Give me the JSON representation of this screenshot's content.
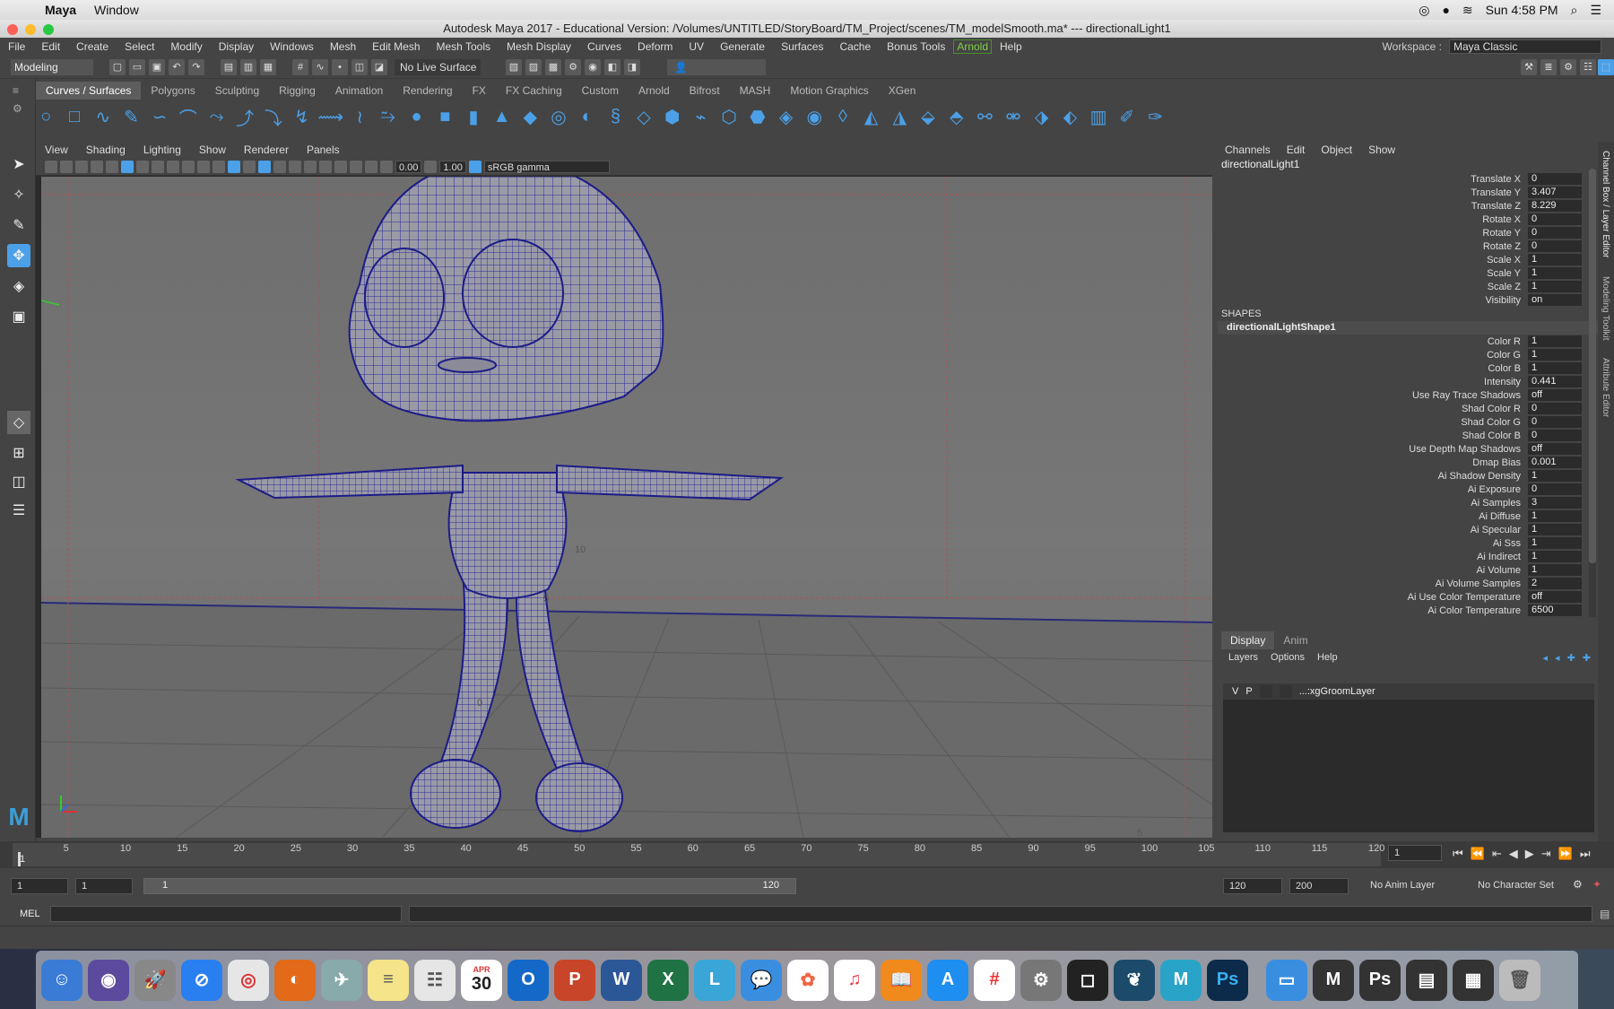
{
  "macos_menubar": {
    "app_name": "Maya",
    "menu": [
      "Window"
    ],
    "clock": "Sun 4:58 PM"
  },
  "window": {
    "title": "Autodesk Maya 2017 - Educational Version: /Volumes/UNTITLED/StoryBoard/TM_Project/scenes/TM_modelSmooth.ma*  ---  directionalLight1"
  },
  "main_menu": [
    "File",
    "Edit",
    "Create",
    "Select",
    "Modify",
    "Display",
    "Windows",
    "Mesh",
    "Edit Mesh",
    "Mesh Tools",
    "Mesh Display",
    "Curves",
    "Deform",
    "UV",
    "Generate",
    "Surfaces",
    "Cache",
    "Bonus Tools",
    "Arnold",
    "Help"
  ],
  "workspace": {
    "label": "Workspace :",
    "value": "Maya Classic"
  },
  "status_line": {
    "menu_set": "Modeling",
    "live_surface": "No Live Surface"
  },
  "shelf_tabs": [
    "Curves / Surfaces",
    "Polygons",
    "Sculpting",
    "Rigging",
    "Animation",
    "Rendering",
    "FX",
    "FX Caching",
    "Custom",
    "Arnold",
    "Bifrost",
    "MASH",
    "Motion Graphics",
    "XGen"
  ],
  "viewport": {
    "menu": [
      "View",
      "Shading",
      "Lighting",
      "Show",
      "Renderer",
      "Panels"
    ],
    "exposure": "0.00",
    "gamma": "1.00",
    "color_space": "sRGB gamma",
    "grid_labels": [
      "10",
      "5",
      "0",
      "5"
    ]
  },
  "channel_box": {
    "menu": [
      "Channels",
      "Edit",
      "Object",
      "Show"
    ],
    "object": "directionalLight1",
    "attributes": [
      {
        "name": "Translate X",
        "value": "0"
      },
      {
        "name": "Translate Y",
        "value": "3.407"
      },
      {
        "name": "Translate Z",
        "value": "8.229"
      },
      {
        "name": "Rotate X",
        "value": "0"
      },
      {
        "name": "Rotate Y",
        "value": "0"
      },
      {
        "name": "Rotate Z",
        "value": "0"
      },
      {
        "name": "Scale X",
        "value": "1"
      },
      {
        "name": "Scale Y",
        "value": "1"
      },
      {
        "name": "Scale Z",
        "value": "1"
      },
      {
        "name": "Visibility",
        "value": "on"
      }
    ],
    "shapes_header": "SHAPES",
    "shape_name": "directionalLightShape1",
    "shape_attributes": [
      {
        "name": "Color R",
        "value": "1"
      },
      {
        "name": "Color G",
        "value": "1"
      },
      {
        "name": "Color B",
        "value": "1"
      },
      {
        "name": "Intensity",
        "value": "0.441"
      },
      {
        "name": "Use Ray Trace Shadows",
        "value": "off"
      },
      {
        "name": "Shad Color R",
        "value": "0"
      },
      {
        "name": "Shad Color G",
        "value": "0"
      },
      {
        "name": "Shad Color B",
        "value": "0"
      },
      {
        "name": "Use Depth Map Shadows",
        "value": "off"
      },
      {
        "name": "Dmap Bias",
        "value": "0.001"
      },
      {
        "name": "Ai Shadow Density",
        "value": "1"
      },
      {
        "name": "Ai Exposure",
        "value": "0"
      },
      {
        "name": "Ai Samples",
        "value": "3"
      },
      {
        "name": "Ai Diffuse",
        "value": "1"
      },
      {
        "name": "Ai Specular",
        "value": "1"
      },
      {
        "name": "Ai Sss",
        "value": "1"
      },
      {
        "name": "Ai Indirect",
        "value": "1"
      },
      {
        "name": "Ai Volume",
        "value": "1"
      },
      {
        "name": "Ai Volume Samples",
        "value": "2"
      },
      {
        "name": "Ai Use Color Temperature",
        "value": "off"
      },
      {
        "name": "Ai Color Temperature",
        "value": "6500"
      }
    ]
  },
  "side_tabs": [
    "Channel Box / Layer Editor",
    "Modeling Toolkit",
    "Attribute Editor"
  ],
  "layer_editor": {
    "tabs": [
      "Display",
      "Anim"
    ],
    "menu": [
      "Layers",
      "Options",
      "Help"
    ],
    "layer": {
      "v": "V",
      "p": "P",
      "name": "...:xgGroomLayer"
    }
  },
  "timeline": {
    "ticks": [
      "5",
      "10",
      "15",
      "20",
      "25",
      "30",
      "35",
      "40",
      "45",
      "50",
      "55",
      "60",
      "65",
      "70",
      "75",
      "80",
      "85",
      "90",
      "95",
      "100",
      "105",
      "110",
      "115",
      "120"
    ],
    "start_label": "1",
    "current_frame": "1"
  },
  "range": {
    "start": "1",
    "anim_start": "1",
    "slider_start": "1",
    "slider_end": "120",
    "anim_end": "120",
    "end": "200",
    "anim_layer": "No Anim Layer",
    "character_set": "No Character Set"
  },
  "mel_label": "MEL",
  "dock": {
    "calendar_month": "APR",
    "calendar_day": "30"
  }
}
